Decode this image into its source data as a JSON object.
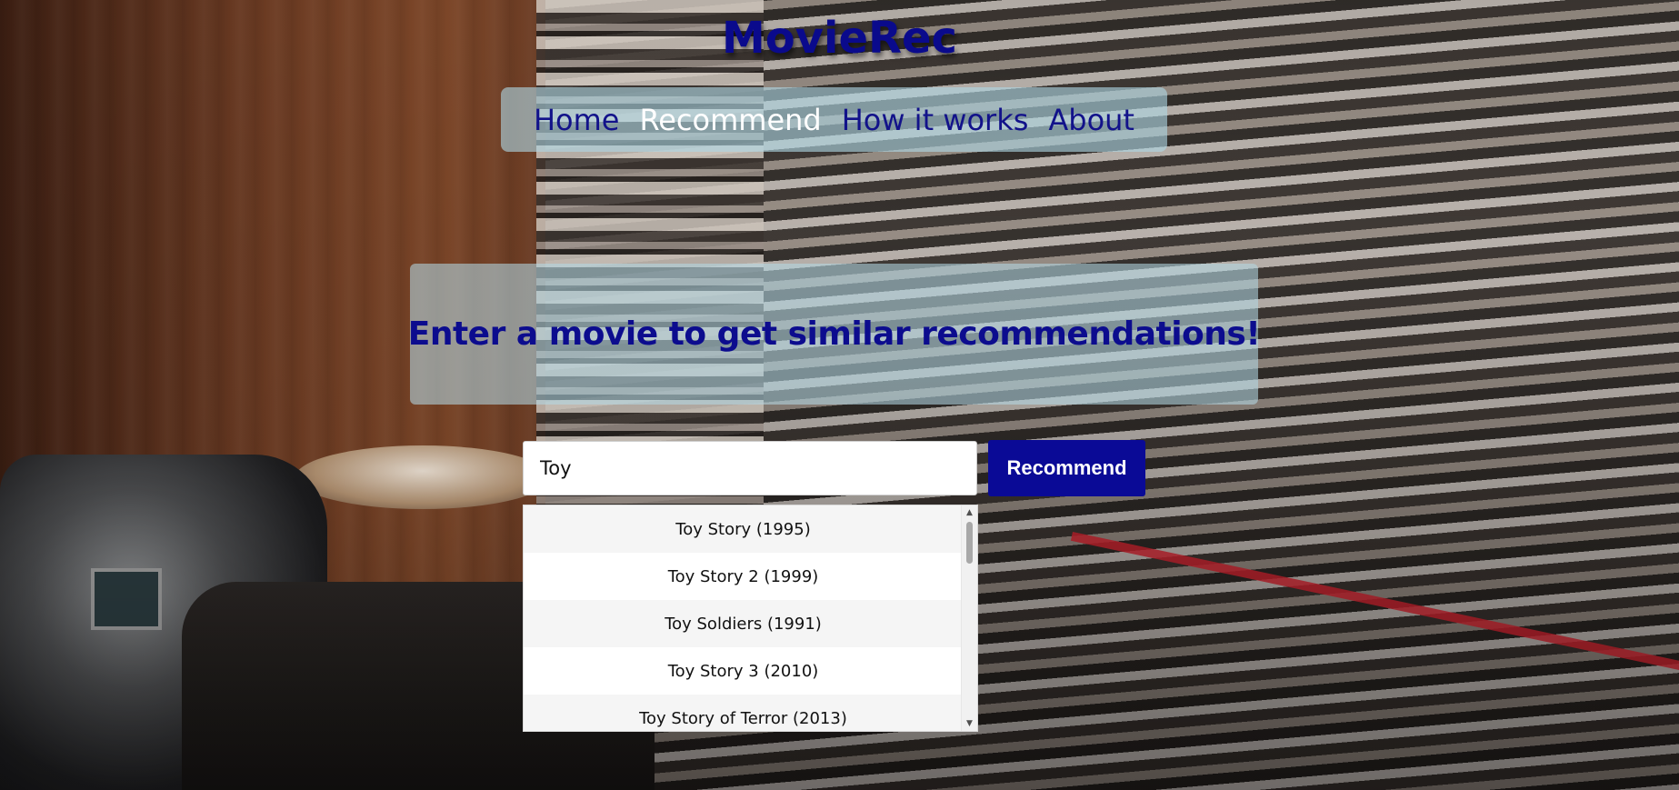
{
  "app": {
    "brand": "MovieRec"
  },
  "nav": {
    "items": [
      {
        "label": "Home",
        "active": false
      },
      {
        "label": "Recommend",
        "active": true
      },
      {
        "label": "How it works",
        "active": false
      },
      {
        "label": "About",
        "active": false
      }
    ]
  },
  "hero": {
    "heading": "Enter a movie to get similar recommendations!"
  },
  "search": {
    "value": "Toy",
    "button_label": "Recommend"
  },
  "suggestions": [
    "Toy Story (1995)",
    "Toy Story 2 (1999)",
    "Toy Soldiers (1991)",
    "Toy Story 3 (2010)",
    "Toy Story of Terror (2013)"
  ],
  "colors": {
    "brand": "#0a0a8c",
    "nav_text": "#12128a",
    "nav_active": "#ffffff",
    "button_bg": "#0a0a96"
  }
}
